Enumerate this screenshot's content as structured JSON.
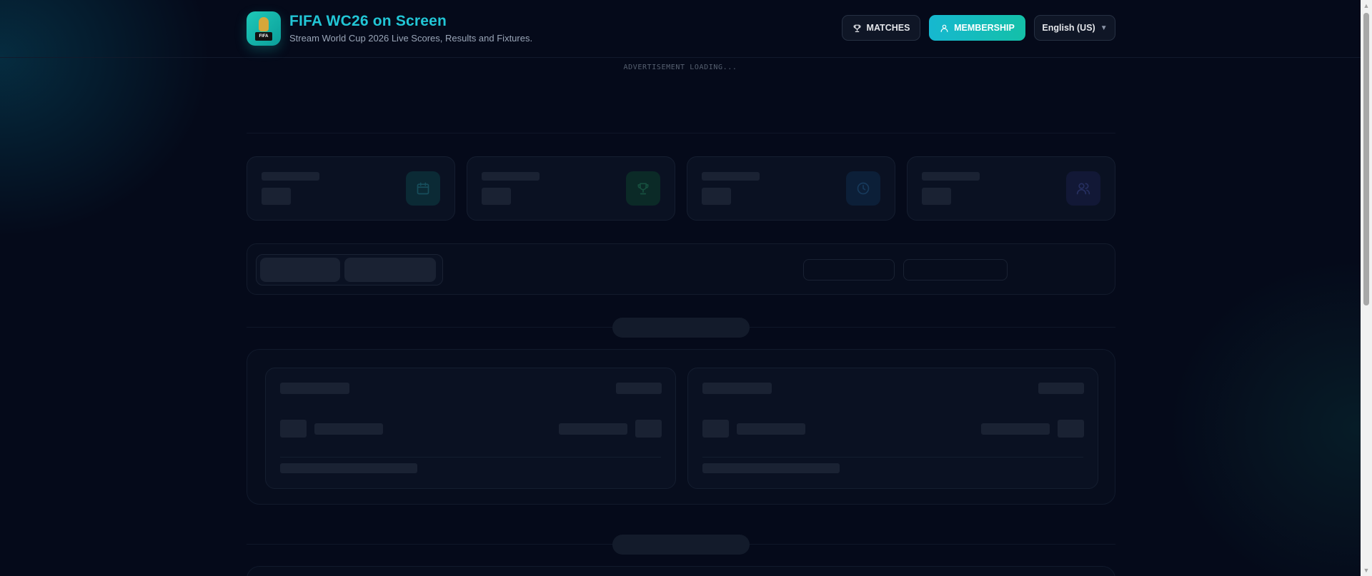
{
  "header": {
    "title": "FIFA WC26 on Screen",
    "subtitle": "Stream World Cup 2026 Live Scores, Results and Fixtures.",
    "logo_text": "FIFA",
    "buttons": {
      "matches": "MATCHES",
      "membership": "MEMBERSHIP",
      "language": "English (US)"
    }
  },
  "ad": {
    "status": "ADVERTISEMENT LOADING..."
  },
  "stats": {
    "cards": [
      {
        "icon": "calendar-icon",
        "accent": "#0f3a4a"
      },
      {
        "icon": "trophy-icon",
        "accent": "#0f3a30"
      },
      {
        "icon": "clock-icon",
        "accent": "#0f2a48"
      },
      {
        "icon": "users-icon",
        "accent": "#1a1f45"
      }
    ]
  },
  "colors": {
    "background": "#050a1a",
    "brand": "#22c6d6",
    "membership_gradient_start": "#16b8d0",
    "membership_gradient_end": "#14c0a8"
  }
}
